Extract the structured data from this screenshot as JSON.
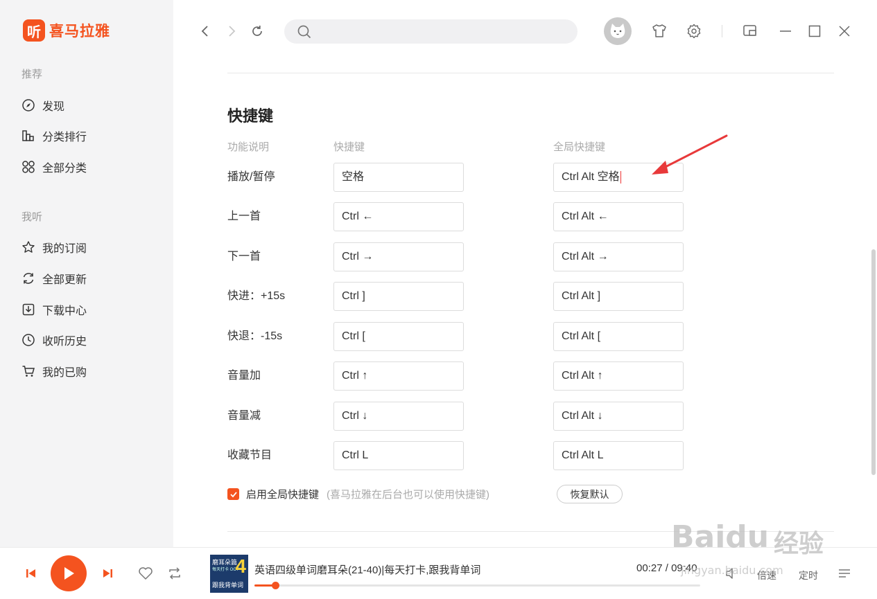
{
  "app": {
    "logo_char": "听",
    "logo_text": "喜马拉雅"
  },
  "sidebar": {
    "section_recommend": "推荐",
    "recommend_items": [
      {
        "label": "发现",
        "icon": "compass-icon"
      },
      {
        "label": "分类排行",
        "icon": "ranking-icon"
      },
      {
        "label": "全部分类",
        "icon": "category-grid-icon"
      }
    ],
    "section_mine": "我听",
    "mine_items": [
      {
        "label": "我的订阅",
        "icon": "star-icon"
      },
      {
        "label": "全部更新",
        "icon": "refresh-cycle-icon"
      },
      {
        "label": "下载中心",
        "icon": "download-icon"
      },
      {
        "label": "收听历史",
        "icon": "clock-icon"
      },
      {
        "label": "我的已购",
        "icon": "cart-icon"
      }
    ]
  },
  "topbar": {
    "search_placeholder": ""
  },
  "shortcuts": {
    "title": "快捷键",
    "col_desc": "功能说明",
    "col_key": "快捷键",
    "col_global": "全局快捷键",
    "rows": [
      {
        "label": "播放/暂停",
        "key": "空格",
        "global": "Ctrl Alt 空格"
      },
      {
        "label": "上一首",
        "key": "Ctrl ←",
        "global": "Ctrl Alt ←"
      },
      {
        "label": "下一首",
        "key": "Ctrl →",
        "global": "Ctrl Alt →"
      },
      {
        "label": "快进：+15s",
        "key": "Ctrl ]",
        "global": "Ctrl Alt ]"
      },
      {
        "label": "快退：-15s",
        "key": "Ctrl [",
        "global": "Ctrl Alt ["
      },
      {
        "label": "音量加",
        "key": "Ctrl ↑",
        "global": "Ctrl Alt ↑"
      },
      {
        "label": "音量减",
        "key": "Ctrl ↓",
        "global": "Ctrl Alt ↓"
      },
      {
        "label": "收藏节目",
        "key": "Ctrl L",
        "global": "Ctrl Alt L"
      }
    ],
    "enable_global_label": "启用全局快捷键",
    "enable_global_checked": true,
    "enable_global_hint": "(喜马拉雅在后台也可以使用快捷键)",
    "restore_label": "恢复默认"
  },
  "player": {
    "cover": {
      "line1": "磨耳朵篇",
      "line2": "每天打卡 OCT",
      "number": "4",
      "line3": "跟我背单词"
    },
    "track_title": "英语四级单词磨耳朵(21-40)|每天打卡,跟我背单词",
    "current_time": "00:27",
    "total_time": "09:40",
    "time_separator": " / ",
    "progress": 0.047,
    "speed_label": "倍速",
    "timer_label": "定时"
  },
  "watermark": {
    "brand": "Baidu",
    "cn": "经验",
    "url": "jingyan.baidu.com"
  },
  "colors": {
    "accent": "#f4531f",
    "sidebar_bg": "#f4f4f5",
    "annotation": "#e8393a"
  }
}
